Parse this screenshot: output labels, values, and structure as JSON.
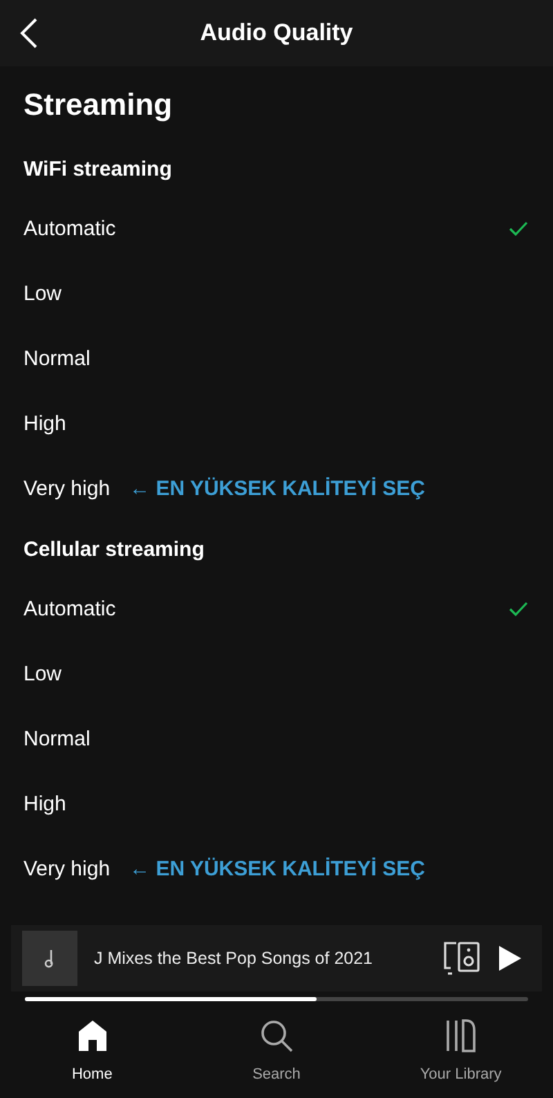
{
  "header": {
    "title": "Audio Quality"
  },
  "page_title": "Streaming",
  "sections": [
    {
      "title": "WiFi streaming",
      "options": [
        {
          "label": "Automatic",
          "selected": true
        },
        {
          "label": "Low",
          "selected": false
        },
        {
          "label": "Normal",
          "selected": false
        },
        {
          "label": "High",
          "selected": false
        },
        {
          "label": "Very high",
          "selected": false,
          "note": "← EN YÜKSEK KALİTEYİ SEÇ"
        }
      ]
    },
    {
      "title": "Cellular streaming",
      "options": [
        {
          "label": "Automatic",
          "selected": true
        },
        {
          "label": "Low",
          "selected": false
        },
        {
          "label": "Normal",
          "selected": false
        },
        {
          "label": "High",
          "selected": false
        },
        {
          "label": "Very high",
          "selected": false,
          "note": "← EN YÜKSEK KALİTEYİ SEÇ"
        }
      ]
    }
  ],
  "player": {
    "title": "J Mixes the Best Pop Songs of 2021",
    "level": 0.58
  },
  "nav": [
    {
      "label": "Home",
      "selected": true
    },
    {
      "label": "Search",
      "selected": false
    },
    {
      "label": "Your Library",
      "selected": false
    }
  ]
}
